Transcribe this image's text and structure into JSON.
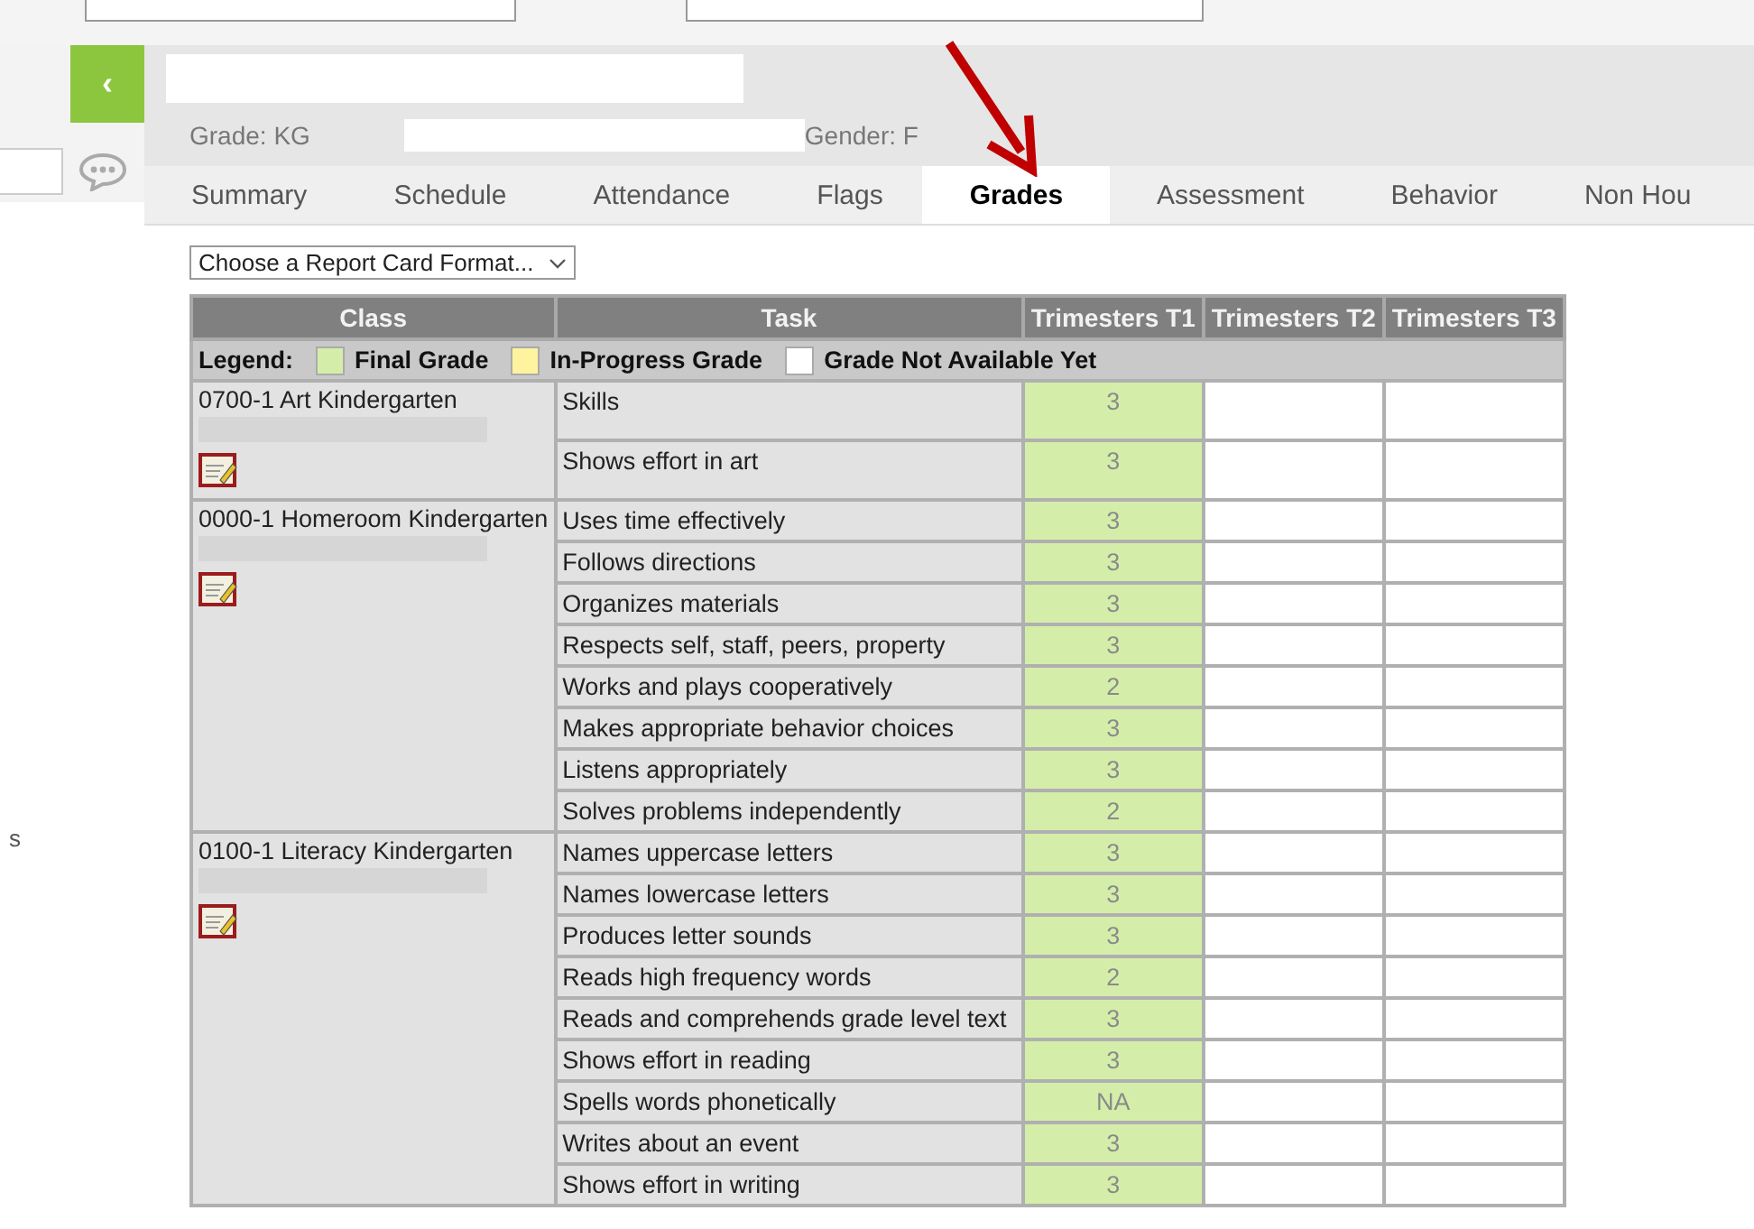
{
  "sidebar": {
    "collapse_button": "‹",
    "stray_text": "s"
  },
  "student": {
    "grade_label": "Grade: KG",
    "gender_label": "Gender: F"
  },
  "tabs": [
    {
      "label": "Summary",
      "selected": false
    },
    {
      "label": "Schedule",
      "selected": false
    },
    {
      "label": "Attendance",
      "selected": false
    },
    {
      "label": "Flags",
      "selected": false
    },
    {
      "label": "Grades",
      "selected": true
    },
    {
      "label": "Assessment",
      "selected": false
    },
    {
      "label": "Behavior",
      "selected": false
    },
    {
      "label": "Non Hou",
      "selected": false
    }
  ],
  "report_format": {
    "value": "Choose a Report Card Format..."
  },
  "table": {
    "columns": [
      "Class",
      "Task",
      "Trimesters T1",
      "Trimesters T2",
      "Trimesters T3"
    ],
    "legend": {
      "label": "Legend:",
      "items": [
        {
          "label": "Final Grade",
          "color": "#d4eeaa"
        },
        {
          "label": "In-Progress Grade",
          "color": "#fff3a0"
        },
        {
          "label": "Grade Not Available Yet",
          "color": "#ffffff"
        }
      ]
    },
    "classes": [
      {
        "name": "0700-1 Art Kindergarten",
        "tasks": [
          {
            "task": "Skills",
            "grade": "3",
            "kind": "final"
          },
          {
            "task": "Shows effort in art",
            "grade": "3",
            "kind": "final"
          }
        ]
      },
      {
        "name": "0000-1 Homeroom Kindergarten",
        "tasks": [
          {
            "task": "Uses time effectively",
            "grade": "3",
            "kind": "final"
          },
          {
            "task": "Follows directions",
            "grade": "3",
            "kind": "final"
          },
          {
            "task": "Organizes materials",
            "grade": "3",
            "kind": "final"
          },
          {
            "task": "Respects self, staff, peers, property",
            "grade": "3",
            "kind": "final"
          },
          {
            "task": "Works and plays cooperatively",
            "grade": "2",
            "kind": "final"
          },
          {
            "task": "Makes appropriate behavior choices",
            "grade": "3",
            "kind": "final"
          },
          {
            "task": "Listens appropriately",
            "grade": "3",
            "kind": "final"
          },
          {
            "task": "Solves problems independently",
            "grade": "2",
            "kind": "final"
          }
        ]
      },
      {
        "name": "0100-1 Literacy Kindergarten",
        "tasks": [
          {
            "task": "Names uppercase letters",
            "grade": "3",
            "kind": "final"
          },
          {
            "task": "Names lowercase letters",
            "grade": "3",
            "kind": "final"
          },
          {
            "task": "Produces letter sounds",
            "grade": "3",
            "kind": "final"
          },
          {
            "task": "Reads high frequency words",
            "grade": "2",
            "kind": "final"
          },
          {
            "task": "Reads and comprehends grade level text",
            "grade": "3",
            "kind": "final"
          },
          {
            "task": "Shows effort in reading",
            "grade": "3",
            "kind": "final"
          },
          {
            "task": "Spells words phonetically",
            "grade": "NA",
            "kind": "final"
          },
          {
            "task": "Writes about an event",
            "grade": "3",
            "kind": "final"
          },
          {
            "task": "Shows effort in writing",
            "grade": "3",
            "kind": "final"
          }
        ]
      }
    ]
  }
}
